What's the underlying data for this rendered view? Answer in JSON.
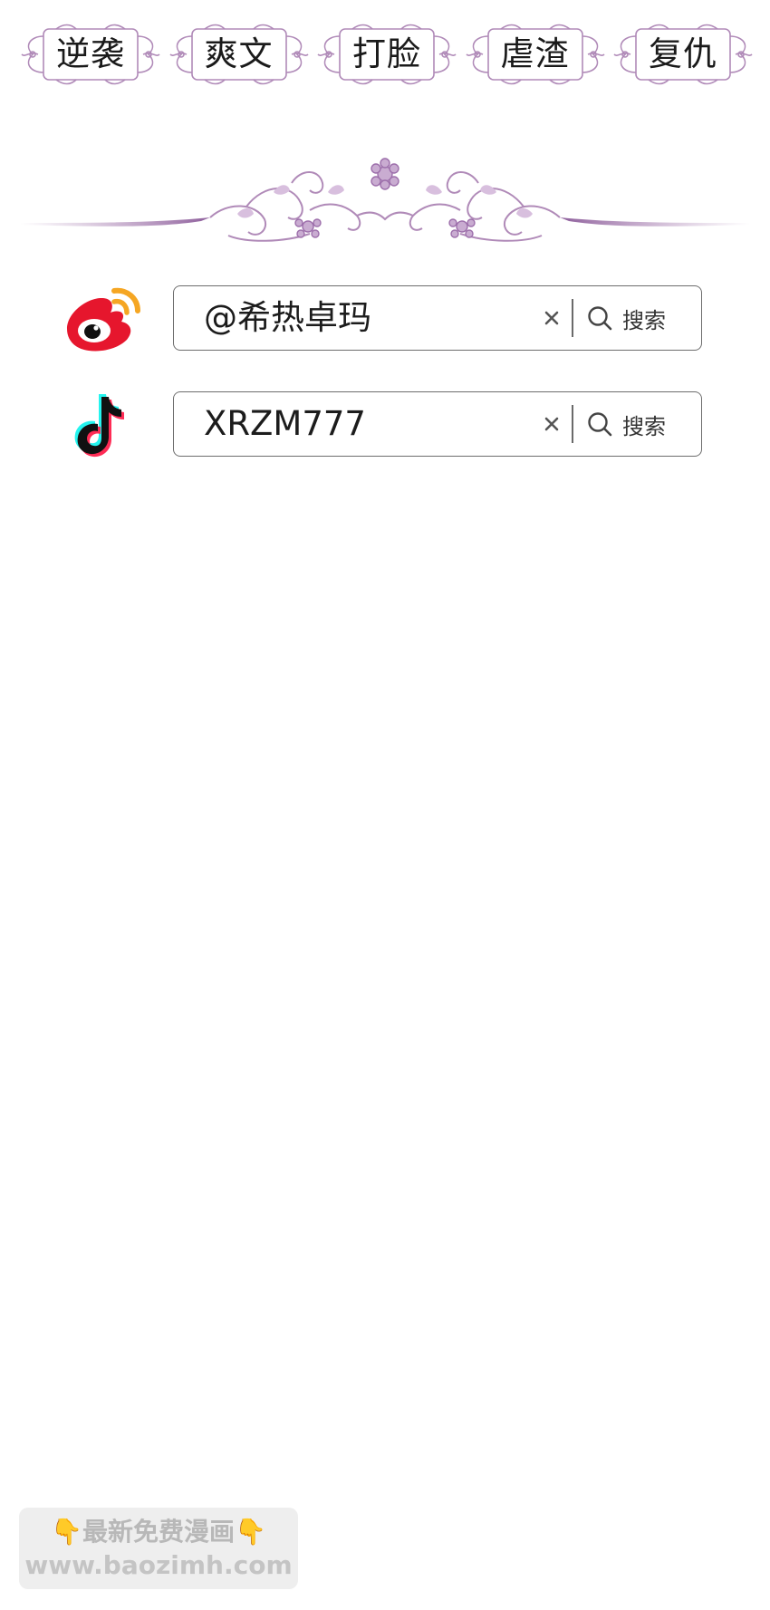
{
  "tags": [
    {
      "label": "逆袭"
    },
    {
      "label": "爽文"
    },
    {
      "label": "打脸"
    },
    {
      "label": "虐渣"
    },
    {
      "label": "复仇"
    }
  ],
  "social": {
    "weibo": {
      "icon": "weibo-logo-icon",
      "value": "@希热卓玛",
      "search_label": "搜索"
    },
    "douyin": {
      "icon": "douyin-logo-icon",
      "value": "XRZM777",
      "search_label": "搜索"
    }
  },
  "watermark": {
    "line1": "最新免费漫画",
    "line2": "www.baozimh.com"
  },
  "colors": {
    "ornament": "#b08ab8",
    "ornament_dark": "#8e5f9c",
    "weibo_red": "#e6162d",
    "weibo_orange": "#f5a623",
    "douyin_cyan": "#25f4ee",
    "douyin_pink": "#fe2c55"
  }
}
